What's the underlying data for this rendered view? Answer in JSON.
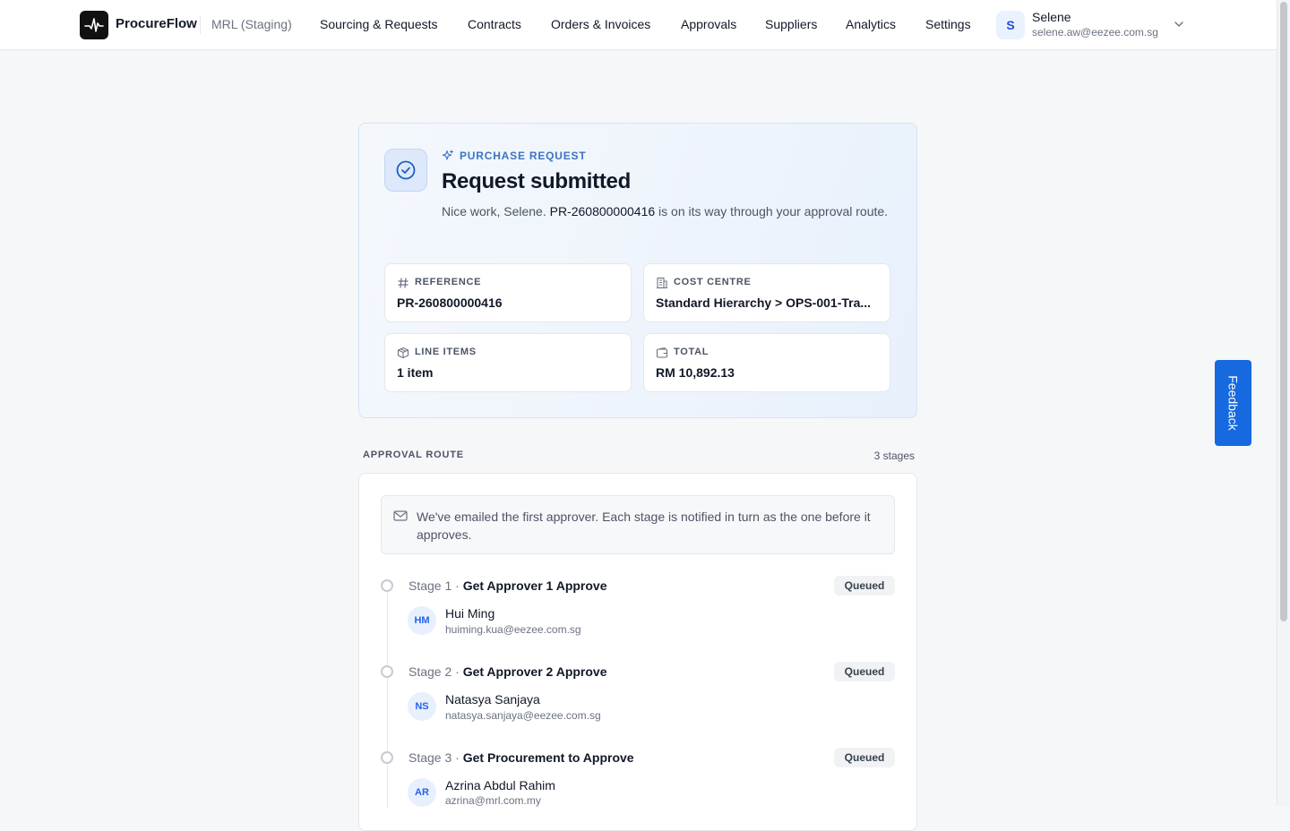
{
  "app": {
    "brand": "ProcureFlow",
    "environment": "MRL (Staging)"
  },
  "nav": {
    "items": [
      {
        "label": "Sourcing & Requests"
      },
      {
        "label": "Contracts"
      },
      {
        "label": "Orders & Invoices"
      },
      {
        "label": "Approvals"
      },
      {
        "label": "Suppliers"
      },
      {
        "label": "Analytics"
      },
      {
        "label": "Settings"
      }
    ]
  },
  "user": {
    "initial": "S",
    "name": "Selene",
    "email": "selene.aw@eezee.com.sg"
  },
  "feedback": {
    "label": "Feedback"
  },
  "request": {
    "eyebrow": "PURCHASE REQUEST",
    "title": "Request submitted",
    "message_prefix": "Nice work, Selene.",
    "message_ref": "PR-260800000416",
    "message_suffix": "is on its way through your approval route.",
    "cards": {
      "reference": {
        "label": "REFERENCE",
        "value": "PR-260800000416",
        "icon": "hash-icon"
      },
      "cost_centre": {
        "label": "COST CENTRE",
        "value": "Standard Hierarchy > OPS-001-Tra...",
        "icon": "building-icon"
      },
      "line_items": {
        "label": "LINE ITEMS",
        "value": "1 item",
        "icon": "box-icon"
      },
      "total": {
        "label": "TOTAL",
        "value": "RM 10,892.13",
        "icon": "wallet-icon"
      }
    }
  },
  "route": {
    "heading": "APPROVAL ROUTE",
    "count": "3 stages",
    "notice": "We've emailed the first approver. Each stage is notified in turn as the one before it approves.",
    "stages": [
      {
        "num": "Stage 1 ·",
        "name": "Get Approver 1 Approve",
        "status": "Queued",
        "approver": {
          "initials": "HM",
          "name": "Hui Ming",
          "email": "huiming.kua@eezee.com.sg"
        }
      },
      {
        "num": "Stage 2 ·",
        "name": "Get Approver 2 Approve",
        "status": "Queued",
        "approver": {
          "initials": "NS",
          "name": "Natasya Sanjaya",
          "email": "natasya.sanjaya@eezee.com.sg"
        }
      },
      {
        "num": "Stage 3 ·",
        "name": "Get Procurement to Approve",
        "status": "Queued",
        "approver": {
          "initials": "AR",
          "name": "Azrina Abdul Rahim",
          "email": "azrina@mrl.com.my"
        }
      }
    ]
  },
  "colors": {
    "accent": "#1769e0",
    "eyebrow": "#3b74c4",
    "avatar_text": "#2563eb"
  }
}
